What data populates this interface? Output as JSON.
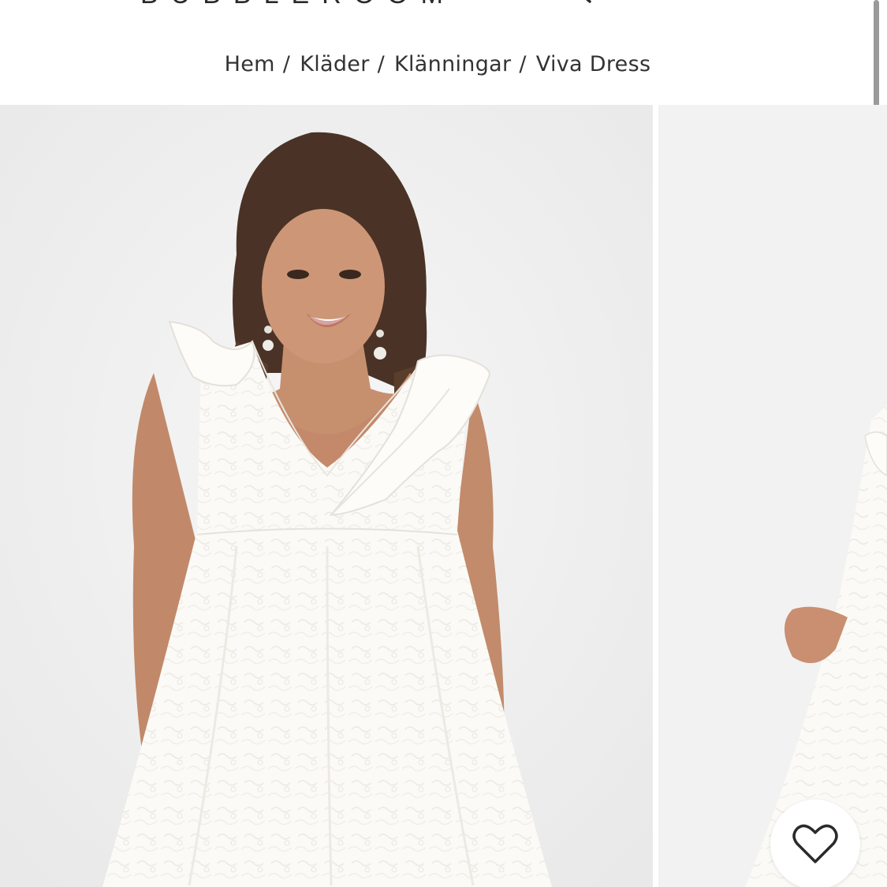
{
  "header": {
    "logo_text": "BUBBLEROOM",
    "menu_icon": "hamburger-menu-icon",
    "icons": [
      "search-icon",
      "account-icon",
      "heart-icon",
      "bag-icon"
    ]
  },
  "breadcrumb": {
    "items": [
      "Hem",
      "Kläder",
      "Klänningar",
      "Viva Dress"
    ],
    "separator": "/"
  },
  "gallery": {
    "images": [
      {
        "description_icon": "product-image-front"
      },
      {
        "description_icon": "product-image-side"
      }
    ],
    "wishlist_icon": "heart-outline-icon"
  },
  "colors": {
    "text": "#2a2a2a",
    "image_background": "#efefef",
    "dress": "#fbfaf6",
    "skin": "#c6906f",
    "hair": "#4a3326"
  }
}
